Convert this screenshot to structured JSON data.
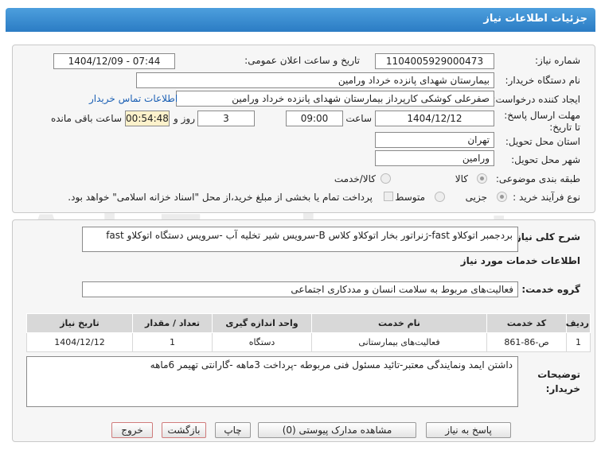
{
  "header": {
    "title": "جزئیات اطلاعات نیاز"
  },
  "fields": {
    "need_number_label": "شماره نیاز:",
    "need_number": "1104005929000473",
    "announce_label": "تاریخ و ساعت اعلان عمومی:",
    "announce_value": "1404/12/09 - 07:44",
    "buyer_org_label": "نام دستگاه خریدار:",
    "buyer_org": "بیمارستان شهدای پانزده خرداد ورامین",
    "creator_label": "ایجاد کننده درخواست:",
    "creator": "صفرعلی کوشکی کارپرداز بیمارستان شهدای پانزده خرداد ورامین",
    "contact_link": "اطلاعات تماس خریدار",
    "deadline_label": "مهلت ارسال پاسخ: تا تاریخ:",
    "deadline_date": "1404/12/12",
    "time_label": "ساعت",
    "deadline_time": "09:00",
    "days_value": "3",
    "days_label": "روز و",
    "remaining_time": "00:54:48",
    "remaining_label": "ساعت باقی مانده",
    "province_label": "استان محل تحویل:",
    "province": "تهران",
    "city_label": "شهر محل تحویل:",
    "city": "ورامین",
    "category_label": "طبقه بندی موضوعی:",
    "category_options": [
      "کالا",
      "کالا/خدمت"
    ],
    "process_label": "نوع فرآیند خرید :",
    "process_options": [
      "جزیی",
      "متوسط"
    ],
    "payment_note": "پرداخت تمام یا بخشی از مبلغ خرید،از محل \"اسناد خزانه اسلامی\" خواهد بود."
  },
  "description": {
    "label": "شرح کلی نیاز:",
    "text": "بردجمبر اتوکلاو fast-ژنراتور بخار اتوکلاو کلاس B-سرویس شیر تخلیه آب -سرویس دستگاه اتوکلاو fast"
  },
  "services": {
    "section_title": "اطلاعات خدمات مورد نیاز",
    "group_label": "گروه خدمت:",
    "group_value": "فعالیت‌های مربوط به سلامت انسان و مددکاری اجتماعی",
    "columns": [
      "ردیف",
      "کد خدمت",
      "نام خدمت",
      "واحد اندازه گیری",
      "تعداد / مقدار",
      "تاریخ نیاز"
    ],
    "rows": [
      [
        "1",
        "ص-86-861",
        "فعالیت‌های بیمارستانی",
        "دستگاه",
        "1",
        "1404/12/12"
      ]
    ]
  },
  "buyer_notes": {
    "label": "توضیحات خریدار:",
    "text": "داشتن ایمد ونمایندگی معتبر-تائید مسئول فنی مربوطه -پرداخت 3ماهه -گارانتی تهیمر 6ماهه"
  },
  "buttons": {
    "reply": "پاسخ به نیاز",
    "attachments": "مشاهده مدارک پیوستی (0)",
    "print": "چاپ",
    "back": "بازگشت",
    "exit": "خروج"
  },
  "watermark": "AriaTender.net"
}
